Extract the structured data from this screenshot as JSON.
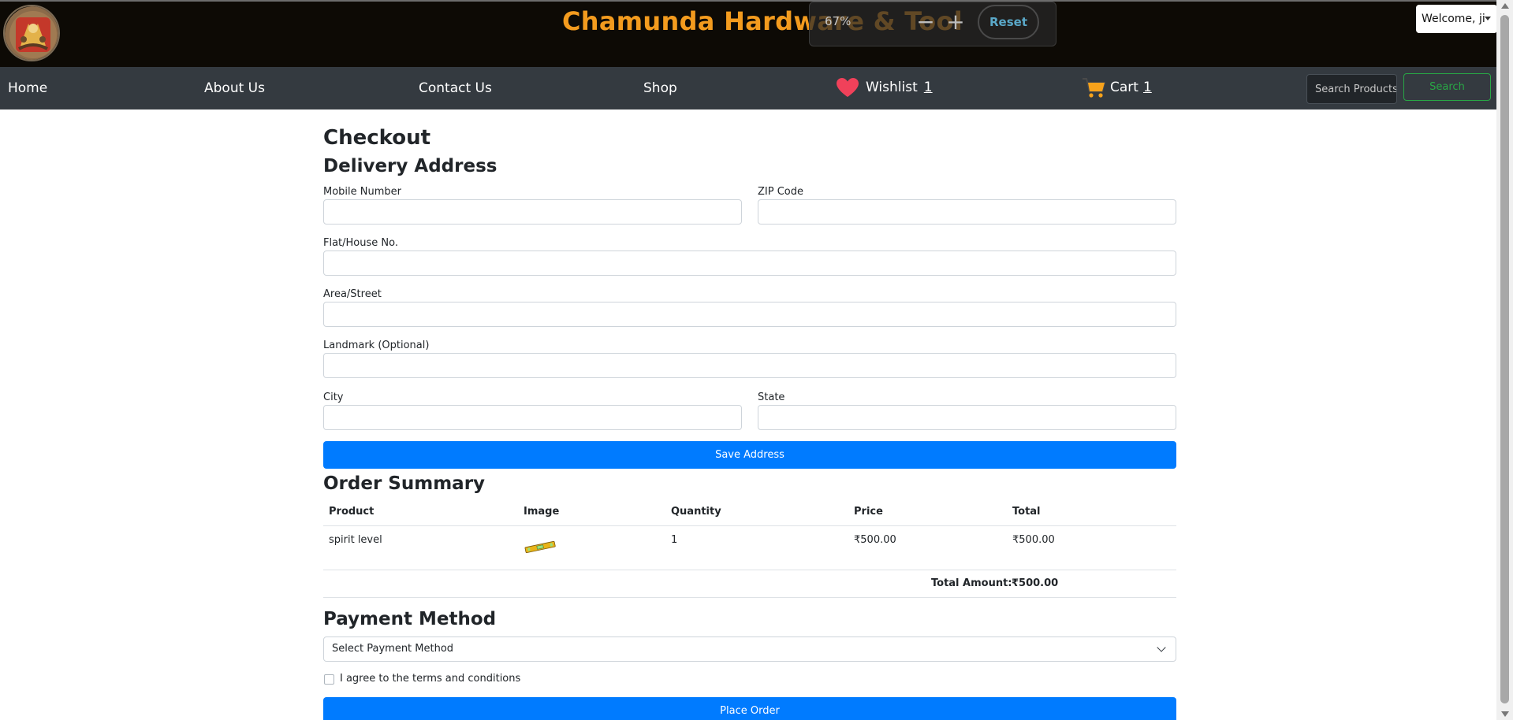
{
  "header": {
    "site_title": "Chamunda Hardware & Tool",
    "welcome": "Welcome, ji"
  },
  "zoom_popup": {
    "percent": "67%",
    "minus": "−",
    "plus": "+",
    "reset": "Reset"
  },
  "nav": {
    "home": "Home",
    "about": "About Us",
    "contact": "Contact Us",
    "shop": "Shop",
    "wishlist_label": "Wishlist",
    "wishlist_count": "1",
    "cart_label": "Cart",
    "cart_count": "1",
    "search_placeholder": "Search Products",
    "search_button": "Search"
  },
  "checkout": {
    "title": "Checkout",
    "delivery_title": "Delivery Address",
    "fields": {
      "mobile": "Mobile Number",
      "zip": "ZIP Code",
      "flat": "Flat/House No.",
      "area": "Area/Street",
      "landmark": "Landmark (Optional)",
      "city": "City",
      "state": "State"
    },
    "save_button": "Save Address",
    "order_summary_title": "Order Summary",
    "table": {
      "headers": [
        "Product",
        "Image",
        "Quantity",
        "Price",
        "Total"
      ],
      "rows": [
        {
          "product": "spirit level",
          "image": "spirit-level-image",
          "quantity": "1",
          "price": "₹500.00",
          "total": "₹500.00"
        }
      ],
      "total_label": "Total Amount:",
      "total_value": "₹500.00"
    },
    "payment_title": "Payment Method",
    "payment_select": "Select Payment Method",
    "terms_label": "I agree to the terms and conditions",
    "place_order_button": "Place Order"
  },
  "colors": {
    "header_bg": "#0d0a05",
    "title_orange": "#f39b1e",
    "nav_bg": "#343a40",
    "primary": "#007bff",
    "search_green": "#28a745",
    "heart_red": "#f0415a",
    "cart_orange": "#f7a21b"
  },
  "icons": [
    "logo-emblem",
    "heart-icon",
    "cart-icon",
    "chevron-down-icon",
    "caret-down-icon"
  ]
}
